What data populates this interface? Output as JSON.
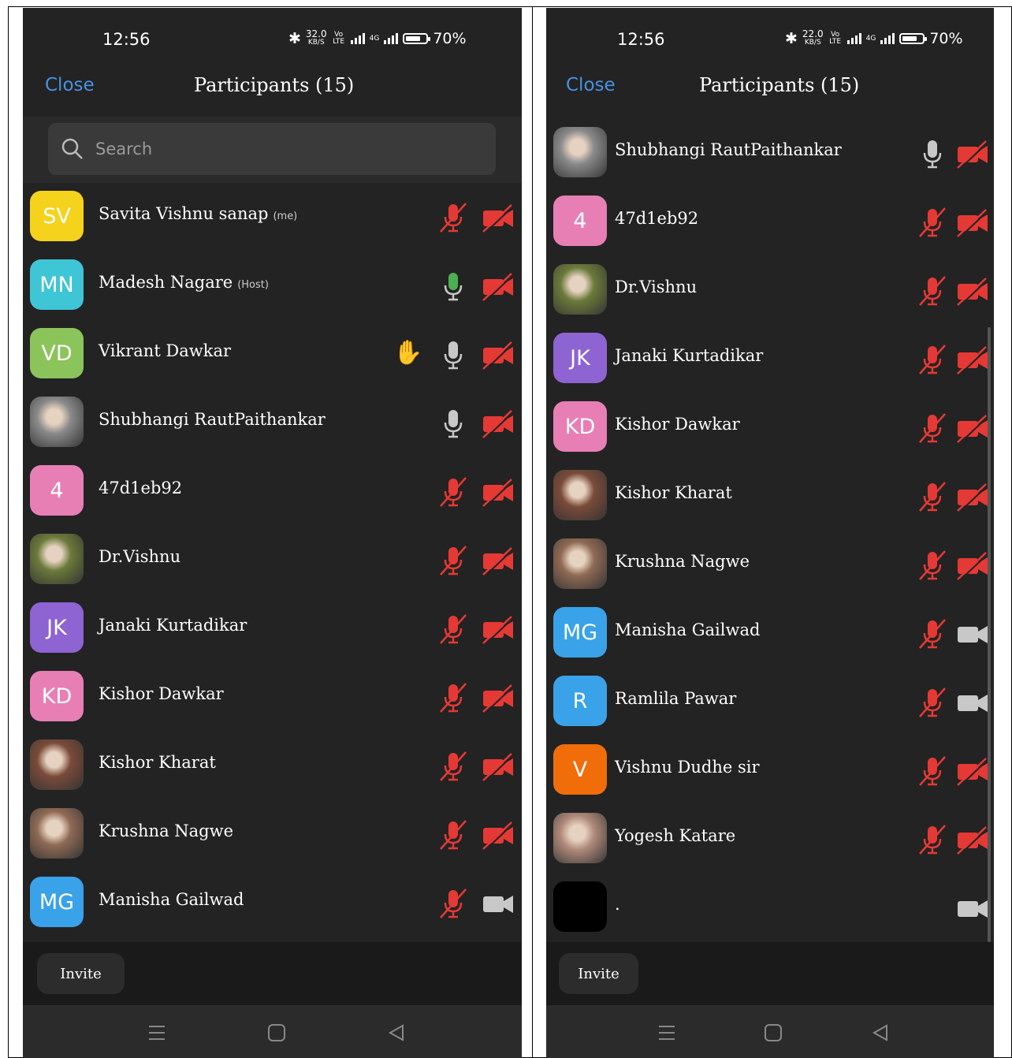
{
  "status": {
    "time": "12:56",
    "speed_left": "32.0",
    "speed_right": "22.0",
    "speed_unit": "KB/S",
    "volte": "Vo LTE",
    "net": "4G",
    "battery": "70%"
  },
  "header": {
    "close": "Close",
    "title": "Participants (15)"
  },
  "search": {
    "placeholder": "Search"
  },
  "footer": {
    "invite": "Invite"
  },
  "colors": {
    "mic_muted": "#e53935",
    "mic_active": "#4caf50",
    "video_off": "#e53935",
    "link": "#4a90e2"
  },
  "left_participants": [
    {
      "initials": "SV",
      "color": "#f5d21b",
      "name": "Savita Vishnu sanap",
      "tag": "(me)",
      "mic": "muted",
      "video": "off"
    },
    {
      "initials": "MN",
      "color": "#3ec5d6",
      "name": "Madesh Nagare",
      "tag": "(Host)",
      "mic": "active",
      "video": "off"
    },
    {
      "initials": "VD",
      "color": "#8bc45a",
      "name": "Vikrant Dawkar",
      "tag": "",
      "mic": "on",
      "video": "off",
      "hand": true
    },
    {
      "initials": "",
      "color": "#8a8a8a",
      "photo": true,
      "name": "Shubhangi RautPaithankar",
      "tag": "",
      "mic": "on",
      "video": "off"
    },
    {
      "initials": "4",
      "color": "#e77fb5",
      "name": "47d1eb92",
      "tag": "",
      "mic": "muted",
      "video": "off"
    },
    {
      "initials": "",
      "color": "#6b7a3a",
      "photo": true,
      "name": "Dr.Vishnu",
      "tag": "",
      "mic": "muted",
      "video": "off"
    },
    {
      "initials": "JK",
      "color": "#8e63d2",
      "name": "Janaki Kurtadikar",
      "tag": "",
      "mic": "muted",
      "video": "off"
    },
    {
      "initials": "KD",
      "color": "#e77fb5",
      "name": "Kishor Dawkar",
      "tag": "",
      "mic": "muted",
      "video": "off"
    },
    {
      "initials": "",
      "color": "#7a4b3a",
      "photo": true,
      "name": "Kishor Kharat",
      "tag": "",
      "mic": "muted",
      "video": "off"
    },
    {
      "initials": "",
      "color": "#8f6a55",
      "photo": true,
      "name": "Krushna Nagwe",
      "tag": "",
      "mic": "muted",
      "video": "off"
    },
    {
      "initials": "MG",
      "color": "#3aa2e8",
      "name": "Manisha Gailwad",
      "tag": "",
      "mic": "muted",
      "video": "on"
    }
  ],
  "right_participants": [
    {
      "initials": "",
      "color": "#8a8a8a",
      "photo": true,
      "name": "Shubhangi RautPaithankar",
      "mic": "on",
      "video": "off"
    },
    {
      "initials": "4",
      "color": "#e77fb5",
      "name": "47d1eb92",
      "mic": "muted",
      "video": "off"
    },
    {
      "initials": "",
      "color": "#6b7a3a",
      "photo": true,
      "name": "Dr.Vishnu",
      "mic": "muted",
      "video": "off"
    },
    {
      "initials": "JK",
      "color": "#8e63d2",
      "name": "Janaki Kurtadikar",
      "mic": "muted",
      "video": "off"
    },
    {
      "initials": "KD",
      "color": "#e77fb5",
      "name": "Kishor Dawkar",
      "mic": "muted",
      "video": "off"
    },
    {
      "initials": "",
      "color": "#7a4b3a",
      "photo": true,
      "name": "Kishor Kharat",
      "mic": "muted",
      "video": "off"
    },
    {
      "initials": "",
      "color": "#8f6a55",
      "photo": true,
      "name": "Krushna Nagwe",
      "mic": "muted",
      "video": "off"
    },
    {
      "initials": "MG",
      "color": "#3aa2e8",
      "name": "Manisha Gailwad",
      "mic": "muted",
      "video": "on"
    },
    {
      "initials": "R",
      "color": "#3aa2e8",
      "name": "Ramlila  Pawar",
      "mic": "muted",
      "video": "on"
    },
    {
      "initials": "V",
      "color": "#f06d0a",
      "name": "Vishnu Dudhe sir",
      "mic": "muted",
      "video": "off"
    },
    {
      "initials": "",
      "color": "#b08a7a",
      "photo": true,
      "name": "Yogesh Katare",
      "mic": "muted",
      "video": "off"
    },
    {
      "initials": "",
      "color": "#000000",
      "name": ".",
      "mic": "none",
      "video": "on"
    }
  ]
}
